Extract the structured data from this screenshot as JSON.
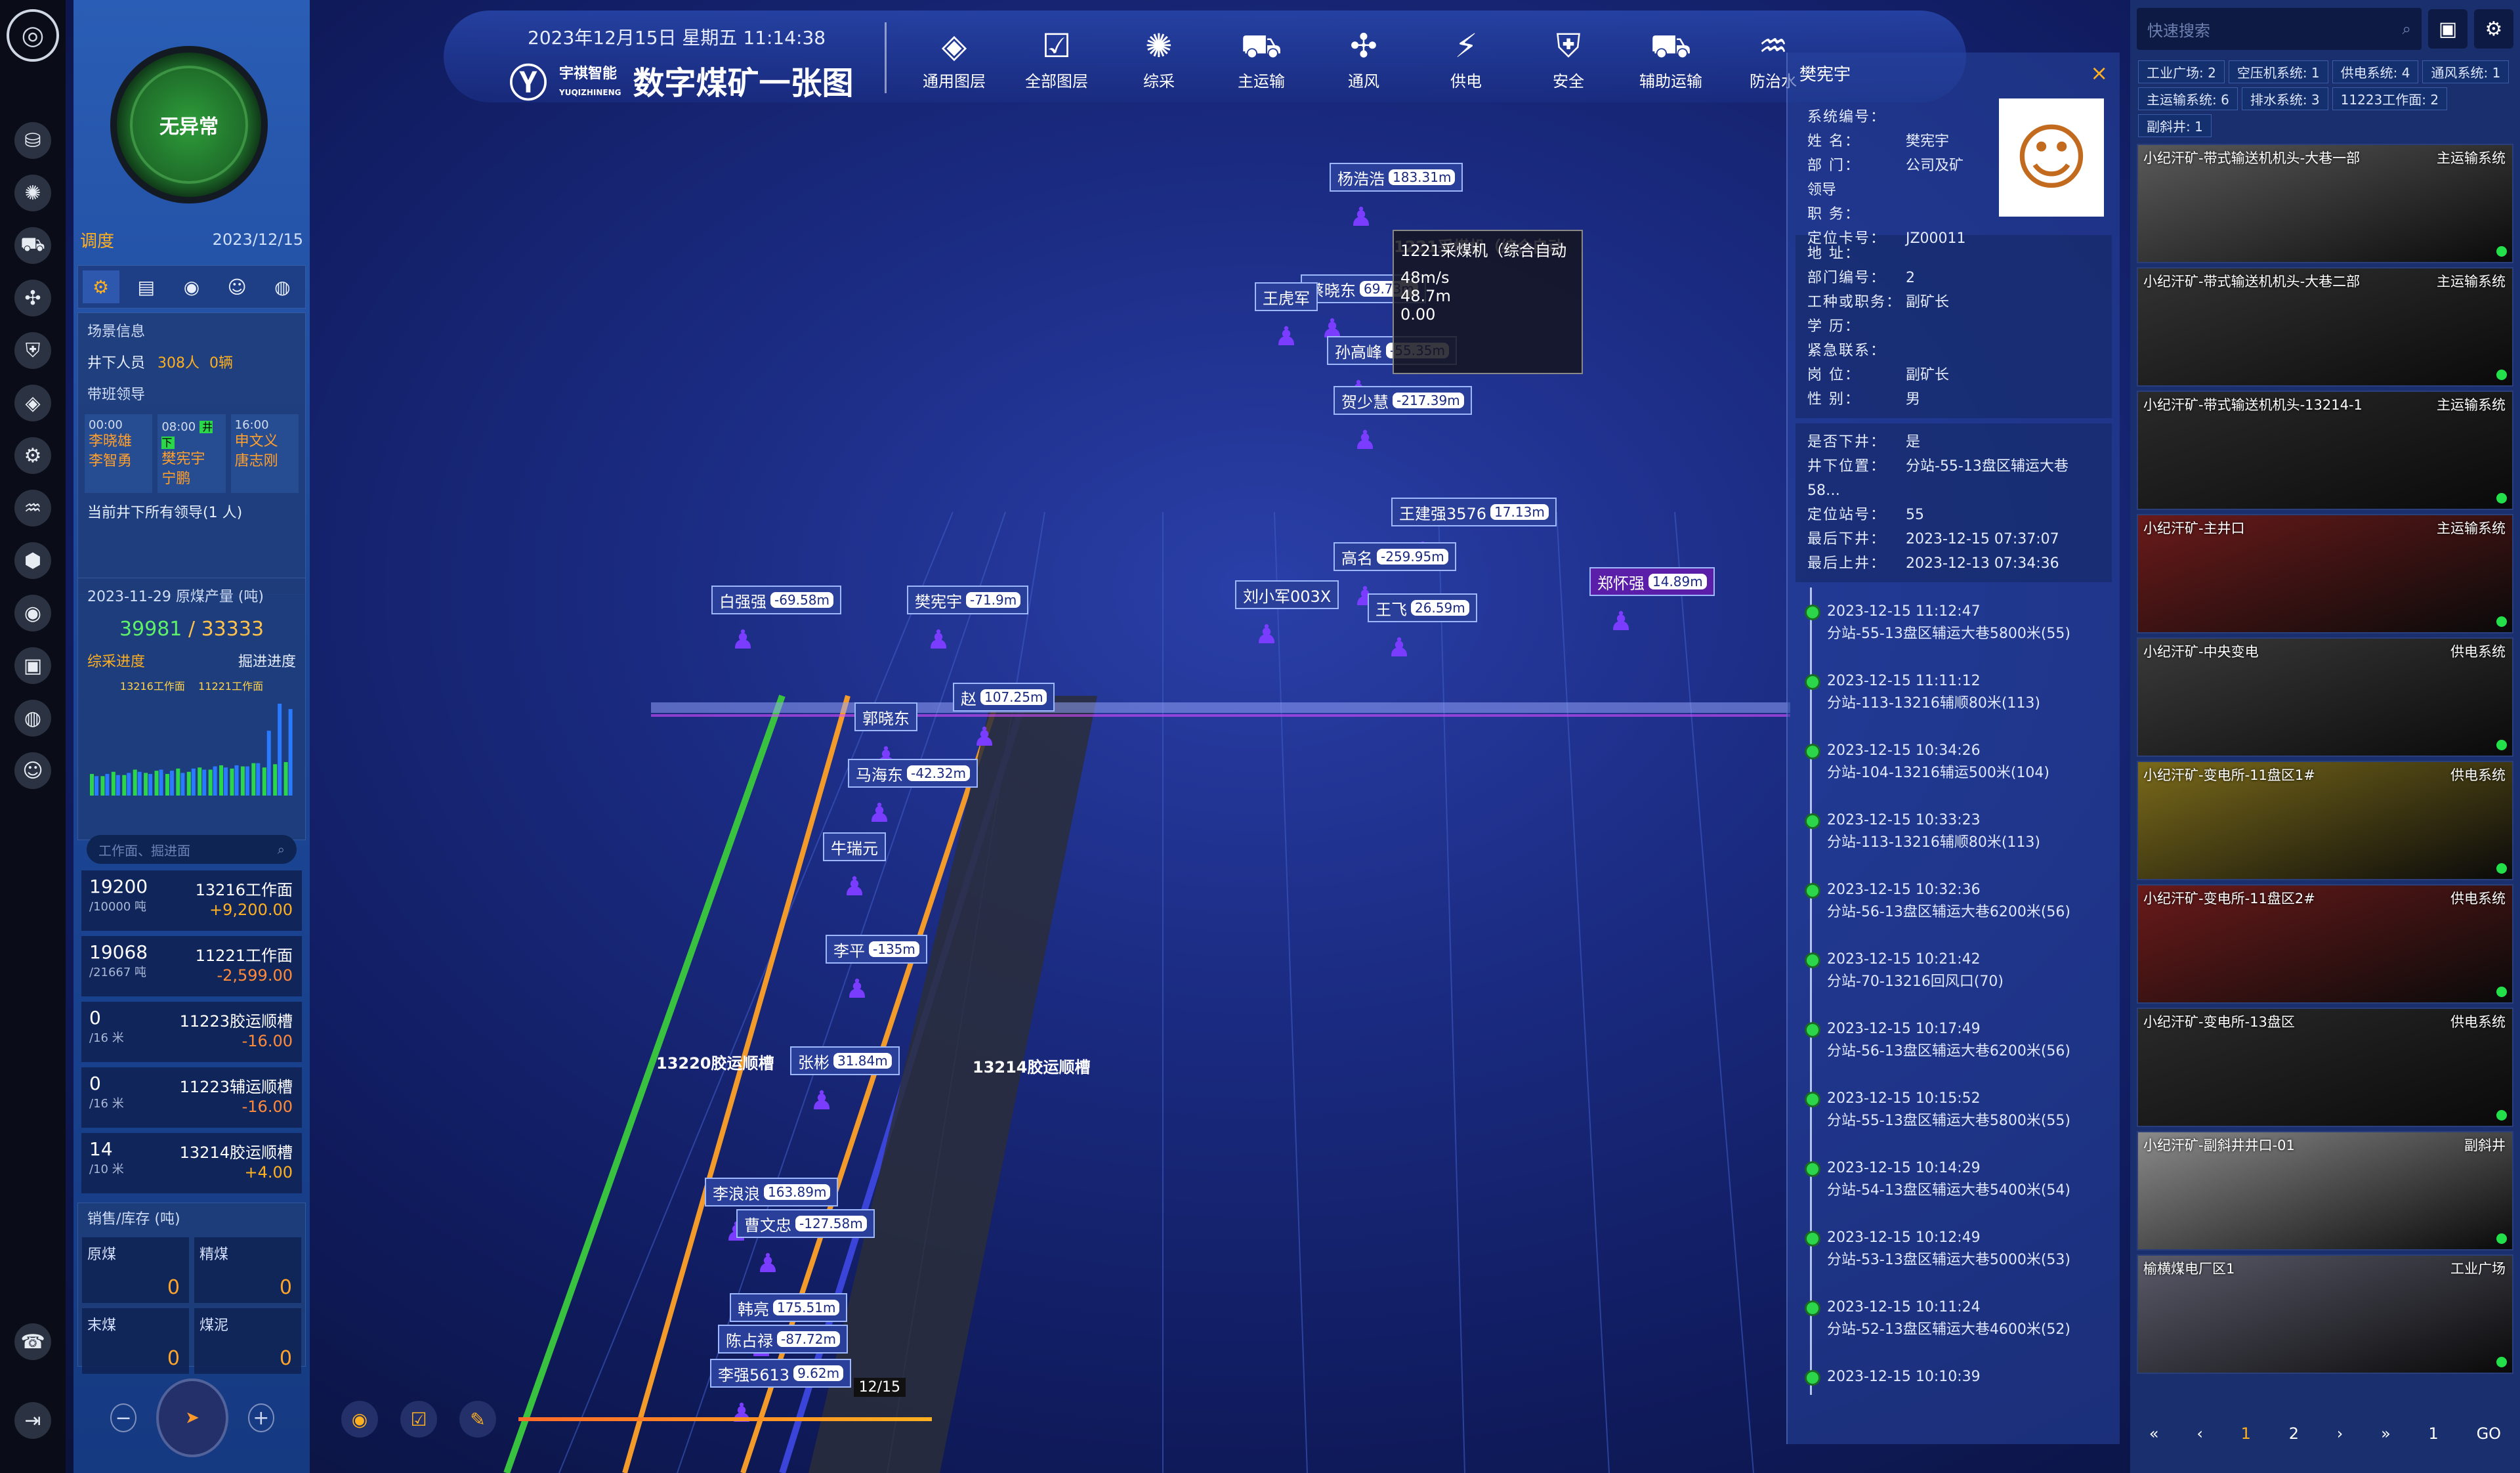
{
  "header": {
    "datetime": "2023年12月15日 星期五 11:14:38",
    "company": "宇祺智能",
    "company_en": "YUQIZHINENG",
    "title": "数字煤矿一张图",
    "menu": [
      {
        "label": "通用图层",
        "icon": "layers-icon",
        "glyph": "◈"
      },
      {
        "label": "全部图层",
        "icon": "checkbox-icon",
        "glyph": "☑"
      },
      {
        "label": "综采",
        "icon": "shearer-icon",
        "glyph": "✺"
      },
      {
        "label": "主运输",
        "icon": "conveyor-icon",
        "glyph": "⛟"
      },
      {
        "label": "通风",
        "icon": "fan-icon",
        "glyph": "✣"
      },
      {
        "label": "供电",
        "icon": "power-icon",
        "glyph": "⚡"
      },
      {
        "label": "安全",
        "icon": "shield-icon",
        "glyph": "⛨"
      },
      {
        "label": "辅助运输",
        "icon": "truck-icon",
        "glyph": "⛟"
      },
      {
        "label": "防治水",
        "icon": "water-icon",
        "glyph": "♒"
      }
    ]
  },
  "left": {
    "status": "无异常",
    "section": "调度",
    "date": "2023/12/15",
    "tabs": [
      "⚙",
      "▤",
      "◉",
      "☺",
      "◍"
    ],
    "scene_info": "场景信息",
    "underground_label": "井下人员",
    "people": "308人",
    "vehicles": "0辆",
    "leaders_title": "带班领导",
    "shifts": [
      {
        "time": "00:00",
        "names": [
          "李晓雄",
          "李智勇"
        ]
      },
      {
        "time": "08:00",
        "badge": "井下",
        "names": [
          "樊宪宇",
          "宁鹏"
        ]
      },
      {
        "time": "16:00",
        "names": [
          "申文义",
          "唐志刚"
        ]
      }
    ],
    "current_leaders": "当前井下所有领导(1 人)",
    "output_title": "2023-11-29 原煤产量 (吨)",
    "output_actual": "39981",
    "output_plan": "33333",
    "progress_left": "综采进度",
    "progress_right": "掘进进度",
    "chart_legend": [
      "13216工作面",
      "11221工作面"
    ],
    "search_placeholder": "工作面、掘进面",
    "workfaces": [
      {
        "value": "19200",
        "unit": "/10000 吨",
        "name": "13216工作面",
        "delta": "+9,200.00",
        "sign": "pos"
      },
      {
        "value": "19068",
        "unit": "/21667 吨",
        "name": "11221工作面",
        "delta": "-2,599.00",
        "sign": "neg"
      },
      {
        "value": "0",
        "unit": "/16 米",
        "name": "11223胶运顺槽",
        "delta": "-16.00",
        "sign": "neg"
      },
      {
        "value": "0",
        "unit": "/16 米",
        "name": "11223辅运顺槽",
        "delta": "-16.00",
        "sign": "neg"
      },
      {
        "value": "14",
        "unit": "/10 米",
        "name": "13214胶运顺槽",
        "delta": "+4.00",
        "sign": "pos"
      }
    ],
    "sales_title": "销售/库存 (吨)",
    "sales": [
      {
        "name": "原煤",
        "value": "0"
      },
      {
        "name": "精煤",
        "value": "0"
      },
      {
        "name": "末煤",
        "value": "0"
      },
      {
        "name": "煤泥",
        "value": "0"
      }
    ]
  },
  "scene": {
    "labels": [
      {
        "name": "杨浩浩",
        "speed": "183.31m",
        "x": 1554,
        "y": 88,
        "purple": false
      },
      {
        "name": "蔡晓东",
        "speed": "69.73m",
        "x": 1510,
        "y": 258,
        "purple": false
      },
      {
        "name": "王虎军",
        "speed": "",
        "x": 1440,
        "y": 270,
        "purple": false
      },
      {
        "name": "孙高峰",
        "speed": "-55.35m",
        "x": 1550,
        "y": 352,
        "purple": false
      },
      {
        "name": "贺少慧",
        "speed": "-217.39m",
        "x": 1560,
        "y": 428,
        "purple": false
      },
      {
        "name": "王建强3576",
        "speed": "17.13m",
        "x": 1648,
        "y": 598,
        "purple": false
      },
      {
        "name": "高名",
        "speed": "-259.95m",
        "x": 1560,
        "y": 666,
        "purple": false
      },
      {
        "name": "刘小军003X",
        "speed": "",
        "x": 1410,
        "y": 724,
        "purple": false
      },
      {
        "name": "王飞",
        "speed": "26.59m",
        "x": 1612,
        "y": 744,
        "purple": false
      },
      {
        "name": "郑怀强",
        "speed": "14.89m",
        "x": 1950,
        "y": 704,
        "purple": true
      },
      {
        "name": "白强强",
        "speed": "-69.58m",
        "x": 612,
        "y": 732,
        "purple": false
      },
      {
        "name": "樊宪宇",
        "speed": "-71.9m",
        "x": 910,
        "y": 732,
        "purple": false
      },
      {
        "name": "赵",
        "speed": "107.25m",
        "x": 980,
        "y": 880,
        "purple": false
      },
      {
        "name": "郭晓东",
        "speed": "",
        "x": 830,
        "y": 910,
        "purple": false
      },
      {
        "name": "马海东",
        "speed": "-42.32m",
        "x": 820,
        "y": 996,
        "purple": false
      },
      {
        "name": "牛瑞元",
        "speed": "",
        "x": 782,
        "y": 1108,
        "purple": false
      },
      {
        "name": "李平",
        "speed": "-135m",
        "x": 786,
        "y": 1264,
        "purple": false
      },
      {
        "name": "张彬",
        "speed": "31.84m",
        "x": 732,
        "y": 1434,
        "purple": false
      },
      {
        "name": "李浪浪",
        "speed": "163.89m",
        "x": 602,
        "y": 1634,
        "purple": false
      },
      {
        "name": "曹文忠",
        "speed": "-127.58m",
        "x": 650,
        "y": 1682,
        "purple": false
      },
      {
        "name": "韩亮",
        "speed": "175.51m",
        "x": 640,
        "y": 1810,
        "purple": false
      },
      {
        "name": "陈占禄",
        "speed": "-87.72m",
        "x": 622,
        "y": 1858,
        "purple": false
      },
      {
        "name": "李强5613",
        "speed": "9.62m",
        "x": 610,
        "y": 1910,
        "purple": false
      }
    ],
    "tunnel_labels": [
      {
        "text": "13220胶运顺槽",
        "x": 528,
        "y": 1440
      },
      {
        "text": "13214胶运顺槽",
        "x": 1010,
        "y": 1446
      },
      {
        "text": "1221采煤机（综合自动",
        "x": 1652,
        "y": 196
      }
    ],
    "popup": [
      "1221采煤机（综合自动",
      "48m/s",
      "48.7m",
      "0.00"
    ],
    "time_marker": "12/15"
  },
  "info": {
    "name": "樊宪宇",
    "fields": [
      {
        "k": "系统编号：",
        "v": ""
      },
      {
        "k": "姓    名：",
        "v": "樊宪宇"
      },
      {
        "k": "部    门：",
        "v": "公司及矿领导"
      },
      {
        "k": "职    务：",
        "v": ""
      },
      {
        "k": "定位卡号：",
        "v": "JZ00011"
      }
    ],
    "fields2": [
      {
        "k": "地    址：",
        "v": ""
      },
      {
        "k": "部门编号：",
        "v": "2"
      },
      {
        "k": "工种或职务：",
        "v": "副矿长"
      },
      {
        "k": "学    历：",
        "v": ""
      },
      {
        "k": "紧急联系：",
        "v": ""
      },
      {
        "k": "岗    位：",
        "v": "副矿长"
      },
      {
        "k": "性    别：",
        "v": "男"
      }
    ],
    "fields3": [
      {
        "k": "是否下井：",
        "v": "是"
      },
      {
        "k": "井下位置：",
        "v": "分站-55-13盘区辅运大巷58…"
      },
      {
        "k": "定位站号：",
        "v": "55"
      },
      {
        "k": "最后下井：",
        "v": "2023-12-15 07:37:07"
      },
      {
        "k": "最后上井：",
        "v": "2023-12-13 07:34:36"
      }
    ],
    "events": [
      {
        "t": "2023-12-15 11:12:47",
        "d": "分站-55-13盘区辅运大巷5800米(55)"
      },
      {
        "t": "2023-12-15 11:11:12",
        "d": "分站-113-13216辅顺80米(113)"
      },
      {
        "t": "2023-12-15 10:34:26",
        "d": "分站-104-13216辅运500米(104)"
      },
      {
        "t": "2023-12-15 10:33:23",
        "d": "分站-113-13216辅顺80米(113)"
      },
      {
        "t": "2023-12-15 10:32:36",
        "d": "分站-56-13盘区辅运大巷6200米(56)"
      },
      {
        "t": "2023-12-15 10:21:42",
        "d": "分站-70-13216回风口(70)"
      },
      {
        "t": "2023-12-15 10:17:49",
        "d": "分站-56-13盘区辅运大巷6200米(56)"
      },
      {
        "t": "2023-12-15 10:15:52",
        "d": "分站-55-13盘区辅运大巷5800米(55)"
      },
      {
        "t": "2023-12-15 10:14:29",
        "d": "分站-54-13盘区辅运大巷5400米(54)"
      },
      {
        "t": "2023-12-15 10:12:49",
        "d": "分站-53-13盘区辅运大巷5000米(53)"
      },
      {
        "t": "2023-12-15 10:11:24",
        "d": "分站-52-13盘区辅运大巷4600米(52)"
      },
      {
        "t": "2023-12-15 10:10:39",
        "d": ""
      }
    ]
  },
  "cameras": {
    "search_placeholder": "快速搜索",
    "tags": [
      "工业广场: 2",
      "空压机系统: 1",
      "供电系统: 4",
      "通风系统: 1",
      "主运输系统: 6",
      "排水系统: 3",
      "11223工作面: 2",
      "副斜井: 1"
    ],
    "list": [
      {
        "title": "小纪汗矿-带式输送机机头-大巷一部",
        "sys": "主运输系统"
      },
      {
        "title": "小纪汗矿-带式输送机机头-大巷二部",
        "sys": "主运输系统"
      },
      {
        "title": "小纪汗矿-带式输送机机头-13214-1",
        "sys": "主运输系统"
      },
      {
        "title": "小纪汗矿-主井口",
        "sys": "主运输系统"
      },
      {
        "title": "小纪汗矿-中央变电",
        "sys": "供电系统"
      },
      {
        "title": "小纪汗矿-变电所-11盘区1#",
        "sys": "供电系统"
      },
      {
        "title": "小纪汗矿-变电所-11盘区2#",
        "sys": "供电系统"
      },
      {
        "title": "小纪汗矿-变电所-13盘区",
        "sys": "供电系统"
      },
      {
        "title": "小纪汗矿-副斜井井口-01",
        "sys": "副斜井"
      },
      {
        "title": "榆横煤电厂区1",
        "sys": "工业广场"
      }
    ],
    "pager": {
      "page1": "1",
      "page2": "2",
      "jump": "1",
      "go": "GO"
    }
  },
  "chart_data": {
    "type": "bar",
    "series": [
      {
        "name": "13216工作面",
        "values": [
          20,
          18,
          22,
          19,
          24,
          21,
          23,
          20,
          25,
          22,
          26,
          24,
          28,
          25,
          27,
          30,
          26,
          29,
          31
        ]
      },
      {
        "name": "11221工作面",
        "values": [
          18,
          20,
          19,
          21,
          22,
          20,
          24,
          23,
          21,
          25,
          24,
          27,
          26,
          28,
          27,
          30,
          60,
          85,
          80
        ]
      }
    ]
  }
}
